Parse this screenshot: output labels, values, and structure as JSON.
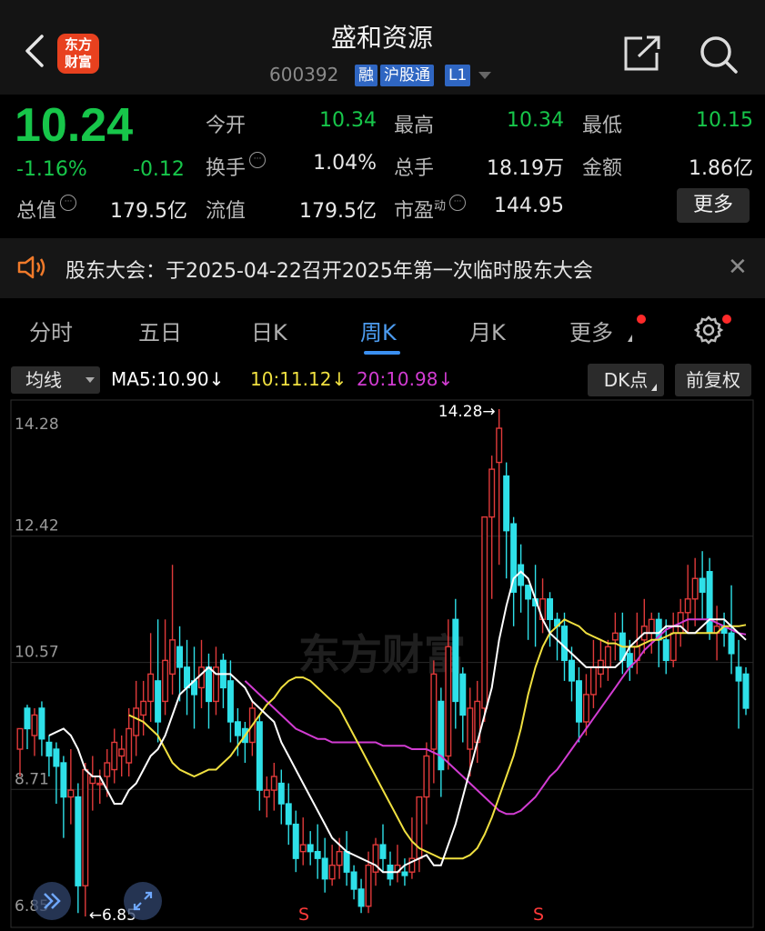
{
  "header": {
    "logo_line1": "东方",
    "logo_line2": "财富",
    "title": "盛和资源",
    "code": "600392",
    "tags": [
      "融",
      "沪股通",
      "L1"
    ]
  },
  "quote": {
    "price": "10.24",
    "change_pct": "-1.16%",
    "change": "-0.12",
    "open_label": "今开",
    "open": "10.34",
    "high_label": "最高",
    "high": "10.34",
    "low_label": "最低",
    "low": "10.15",
    "turnover_label": "换手",
    "turnover": "1.04%",
    "volume_label": "总手",
    "volume": "18.19万",
    "amount_label": "金额",
    "amount": "1.86亿",
    "mktcap_label": "总值",
    "mktcap": "179.5亿",
    "float_label": "流值",
    "float": "179.5亿",
    "pe_label": "市盈",
    "pe_sup": "动",
    "pe": "144.95",
    "more_label": "更多"
  },
  "notice": {
    "text": "股东大会：于2025-04-22召开2025年第一次临时股东大会"
  },
  "tabs": [
    {
      "label": "分时"
    },
    {
      "label": "五日"
    },
    {
      "label": "日K"
    },
    {
      "label": "周K"
    },
    {
      "label": "月K"
    },
    {
      "label": "更多"
    }
  ],
  "ma_bar": {
    "selector": "均线",
    "ma5": "MA5:10.90",
    "ma10": "10:11.12",
    "ma20": "20:10.98",
    "arrow": "↓",
    "dk_label": "DK点",
    "adjust_label": "前复权"
  },
  "colors": {
    "up": "#e03a3a",
    "down": "#2ee0e8",
    "ma5": "#ffffff",
    "ma10": "#f0e040",
    "ma20": "#d23cd2",
    "price_green": "#17c64a",
    "accent": "#3a8ff0"
  },
  "watermark": "东方财富",
  "chart_data": {
    "type": "candlestick",
    "ylim": [
      6.85,
      14.28
    ],
    "y_ticks": [
      "14.28",
      "12.42",
      "10.57",
      "8.71",
      "6.85"
    ],
    "y_tick_values": [
      14.28,
      12.42,
      10.57,
      8.71,
      6.85
    ],
    "max_label": "14.28→",
    "min_label": "←6.85",
    "signals": [
      "S",
      "S"
    ],
    "candles": [
      [
        9.3,
        9.6,
        8.9,
        9.6
      ],
      [
        9.9,
        9.6,
        9.3,
        9.95
      ],
      [
        9.5,
        9.8,
        9.2,
        9.9
      ],
      [
        9.9,
        9.45,
        9.2,
        10.0
      ],
      [
        9.4,
        9.2,
        8.9,
        9.5
      ],
      [
        9.3,
        9.05,
        8.5,
        9.4
      ],
      [
        9.1,
        8.6,
        8.0,
        9.2
      ],
      [
        8.6,
        8.7,
        8.2,
        9.3
      ],
      [
        8.6,
        7.3,
        6.9,
        8.8
      ],
      [
        7.3,
        9.0,
        6.85,
        9.1
      ],
      [
        8.8,
        8.9,
        8.4,
        9.2
      ],
      [
        8.8,
        8.8,
        8.5,
        9.0
      ],
      [
        8.9,
        9.1,
        8.6,
        9.3
      ],
      [
        9.0,
        9.4,
        8.8,
        9.6
      ],
      [
        9.2,
        9.3,
        8.9,
        9.5
      ],
      [
        9.1,
        9.6,
        8.9,
        9.9
      ],
      [
        9.5,
        9.9,
        9.2,
        10.3
      ],
      [
        9.8,
        10.0,
        9.5,
        10.3
      ],
      [
        10.0,
        10.4,
        9.7,
        11.0
      ],
      [
        10.3,
        9.7,
        9.4,
        11.2
      ],
      [
        10.0,
        10.6,
        9.8,
        11.2
      ],
      [
        10.4,
        10.9,
        10.1,
        12.0
      ],
      [
        10.8,
        10.5,
        10.0,
        11.1
      ],
      [
        10.5,
        10.2,
        9.8,
        10.9
      ],
      [
        10.3,
        10.1,
        9.6,
        10.8
      ],
      [
        10.2,
        10.5,
        9.9,
        10.9
      ],
      [
        10.5,
        10.0,
        9.6,
        10.7
      ],
      [
        10.0,
        10.5,
        9.8,
        10.8
      ],
      [
        10.6,
        10.2,
        9.9,
        10.7
      ],
      [
        10.3,
        9.7,
        9.4,
        10.6
      ],
      [
        9.7,
        9.5,
        9.2,
        9.9
      ],
      [
        9.6,
        9.4,
        9.1,
        9.7
      ],
      [
        9.4,
        9.9,
        9.2,
        10.0
      ],
      [
        9.7,
        8.7,
        8.4,
        9.8
      ],
      [
        8.6,
        8.7,
        8.3,
        8.9
      ],
      [
        8.7,
        8.9,
        8.4,
        9.1
      ],
      [
        8.8,
        8.5,
        8.2,
        9.0
      ],
      [
        8.5,
        8.2,
        7.9,
        8.8
      ],
      [
        8.2,
        7.7,
        7.5,
        8.4
      ],
      [
        7.8,
        7.9,
        7.6,
        8.3
      ],
      [
        7.9,
        7.8,
        7.6,
        8.1
      ],
      [
        7.8,
        7.7,
        7.4,
        8.2
      ],
      [
        7.7,
        7.4,
        7.2,
        8.0
      ],
      [
        7.4,
        7.6,
        7.3,
        7.9
      ],
      [
        7.6,
        7.8,
        7.4,
        8.0
      ],
      [
        7.8,
        7.5,
        7.3,
        8.1
      ],
      [
        7.5,
        7.25,
        7.1,
        7.6
      ],
      [
        7.25,
        7.0,
        6.9,
        7.4
      ],
      [
        7.0,
        7.6,
        6.9,
        7.8
      ],
      [
        7.5,
        7.9,
        7.3,
        8.0
      ],
      [
        7.9,
        7.7,
        7.5,
        8.2
      ],
      [
        7.6,
        7.4,
        7.3,
        7.8
      ],
      [
        7.5,
        7.6,
        7.35,
        7.9
      ],
      [
        7.5,
        7.45,
        7.3,
        7.7
      ],
      [
        7.5,
        7.7,
        7.4,
        8.3
      ],
      [
        7.7,
        8.6,
        7.5,
        8.6
      ],
      [
        8.6,
        9.2,
        8.2,
        9.4
      ],
      [
        9.3,
        10.4,
        8.8,
        10.6
      ],
      [
        10.0,
        9.0,
        8.6,
        10.2
      ],
      [
        9.2,
        10.8,
        9.0,
        11.2
      ],
      [
        11.2,
        10.0,
        9.6,
        11.5
      ],
      [
        10.4,
        9.8,
        9.4,
        10.5
      ],
      [
        9.3,
        9.9,
        8.9,
        10.2
      ],
      [
        9.4,
        10.0,
        9.1,
        10.3
      ],
      [
        9.9,
        12.7,
        9.7,
        12.7
      ],
      [
        12.7,
        13.4,
        11.5,
        13.6
      ],
      [
        13.5,
        14.0,
        12.0,
        14.28
      ],
      [
        13.3,
        12.5,
        11.8,
        13.5
      ],
      [
        12.6,
        11.6,
        11.1,
        12.7
      ],
      [
        12.0,
        11.7,
        11.3,
        12.3
      ],
      [
        11.7,
        11.5,
        10.9,
        11.7
      ],
      [
        11.5,
        11.4,
        10.8,
        12.0
      ],
      [
        11.2,
        11.5,
        11.0,
        11.8
      ],
      [
        11.5,
        11.2,
        10.8,
        11.6
      ],
      [
        11.2,
        11.1,
        10.6,
        11.3
      ],
      [
        11.1,
        10.6,
        10.3,
        11.3
      ],
      [
        10.6,
        10.3,
        10.0,
        10.8
      ],
      [
        10.3,
        9.7,
        9.4,
        10.5
      ],
      [
        9.7,
        10.1,
        9.5,
        10.4
      ],
      [
        10.1,
        10.5,
        9.9,
        10.9
      ],
      [
        10.4,
        10.6,
        10.2,
        10.9
      ],
      [
        10.5,
        10.8,
        10.3,
        10.9
      ],
      [
        10.9,
        11.0,
        10.6,
        11.3
      ],
      [
        11.0,
        10.6,
        10.4,
        11.3
      ],
      [
        10.7,
        10.5,
        10.3,
        10.9
      ],
      [
        10.6,
        10.8,
        10.4,
        11.3
      ],
      [
        10.9,
        11.1,
        10.7,
        11.5
      ],
      [
        11.0,
        11.2,
        10.7,
        11.3
      ],
      [
        11.2,
        10.9,
        10.5,
        11.3
      ],
      [
        10.9,
        10.6,
        10.4,
        11.2
      ],
      [
        10.6,
        11.0,
        10.5,
        11.3
      ],
      [
        11.0,
        11.3,
        10.8,
        11.5
      ],
      [
        11.3,
        11.5,
        11.0,
        12.0
      ],
      [
        11.5,
        11.8,
        11.1,
        12.1
      ],
      [
        11.8,
        11.6,
        11.2,
        12.2
      ],
      [
        11.9,
        11.0,
        10.9,
        12.1
      ],
      [
        11.0,
        11.1,
        10.6,
        11.4
      ],
      [
        11.1,
        11.0,
        10.8,
        11.3
      ],
      [
        11.0,
        10.7,
        10.4,
        11.7
      ],
      [
        10.5,
        10.3,
        9.6,
        10.9
      ],
      [
        10.4,
        9.9,
        9.8,
        10.5
      ]
    ],
    "ma5": [
      9.5,
      9.55,
      9.6,
      9.5,
      9.3,
      9.0,
      8.9,
      8.9,
      8.7,
      8.5,
      8.5,
      8.7,
      8.8,
      9.0,
      9.2,
      9.3,
      9.5,
      9.8,
      10.1,
      10.2,
      10.3,
      10.4,
      10.5,
      10.4,
      10.4,
      10.4,
      10.3,
      10.2,
      10.0,
      9.9,
      9.8,
      9.7,
      9.4,
      9.2,
      9.0,
      8.8,
      8.6,
      8.4,
      8.2,
      8.0,
      7.9,
      7.8,
      7.75,
      7.7,
      7.65,
      7.6,
      7.5,
      7.5,
      7.5,
      7.6,
      7.65,
      7.7,
      7.75,
      7.6,
      7.6,
      7.9,
      8.2,
      8.6,
      9.0,
      9.4,
      9.8,
      10.2,
      10.9,
      11.4,
      11.8,
      11.9,
      11.8,
      11.5,
      11.2,
      11.0,
      10.9,
      10.8,
      10.7,
      10.6,
      10.5,
      10.5,
      10.5,
      10.5,
      10.5,
      10.6,
      10.8,
      10.9,
      11.0,
      11.0,
      11.0,
      11.1,
      11.1,
      11.1,
      11.0,
      11.0,
      11.1,
      11.2,
      11.2,
      11.2,
      11.1,
      11.0,
      10.9
    ],
    "ma10": [
      9.8,
      9.75,
      9.7,
      9.6,
      9.5,
      9.3,
      9.1,
      9.0,
      8.95,
      8.9,
      8.95,
      9.0,
      9.0,
      9.1,
      9.2,
      9.35,
      9.5,
      9.65,
      9.8,
      9.95,
      10.05,
      10.2,
      10.3,
      10.35,
      10.35,
      10.3,
      10.2,
      10.1,
      10.0,
      9.9,
      9.7,
      9.5,
      9.3,
      9.1,
      8.9,
      8.7,
      8.5,
      8.3,
      8.1,
      7.95,
      7.85,
      7.8,
      7.75,
      7.7,
      7.7,
      7.7,
      7.7,
      7.75,
      7.85,
      8.05,
      8.3,
      8.6,
      8.9,
      9.2,
      9.6,
      10.1,
      10.5,
      10.8,
      11.0,
      11.1,
      11.2,
      11.15,
      11.1,
      11.0,
      10.95,
      10.9,
      10.85,
      10.85,
      10.8,
      10.8,
      10.8,
      10.85,
      10.9,
      10.9,
      10.95,
      11.0,
      11.0,
      11.0,
      11.0,
      11.0,
      11.0,
      11.0,
      11.1,
      11.1,
      11.1,
      11.12
    ],
    "ma20": [
      10.3,
      10.2,
      10.1,
      10.0,
      9.9,
      9.8,
      9.7,
      9.6,
      9.55,
      9.5,
      9.45,
      9.45,
      9.4,
      9.4,
      9.4,
      9.4,
      9.4,
      9.4,
      9.4,
      9.35,
      9.35,
      9.35,
      9.35,
      9.3,
      9.3,
      9.3,
      9.25,
      9.2,
      9.1,
      9.0,
      8.9,
      8.8,
      8.7,
      8.6,
      8.5,
      8.4,
      8.35,
      8.35,
      8.4,
      8.5,
      8.6,
      8.75,
      8.9,
      9.0,
      9.15,
      9.3,
      9.45,
      9.6,
      9.75,
      9.9,
      10.05,
      10.2,
      10.35,
      10.5,
      10.6,
      10.75,
      10.85,
      10.95,
      11.05,
      11.1,
      11.15,
      11.2,
      11.2,
      11.2,
      11.2,
      11.15,
      11.1,
      11.05,
      11.0,
      10.98
    ]
  }
}
